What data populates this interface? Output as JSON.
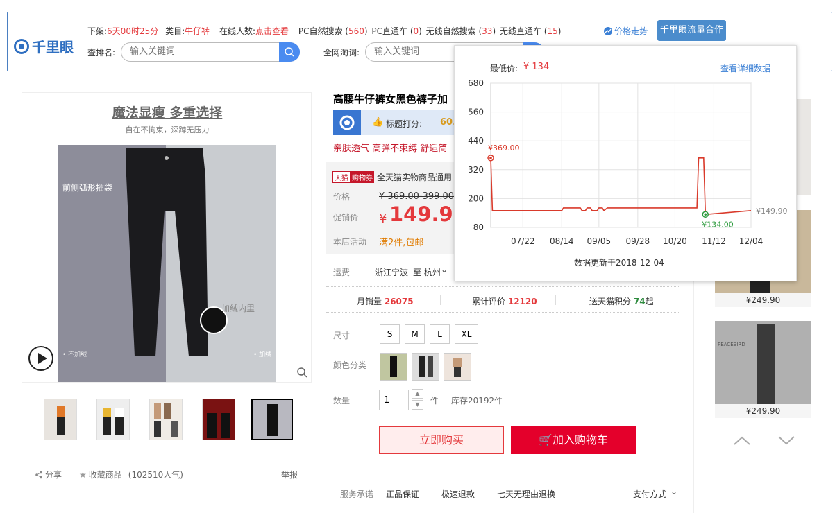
{
  "toolbar": {
    "logo_text": "千里眼",
    "shelf_label": "下架:",
    "shelf_value": "6天00时25分",
    "category_label": "类目:",
    "category_value": "牛仔裤",
    "online_label": "在线人数:",
    "online_value": "点击查看",
    "pc_natural_label": "PC自然搜索 (",
    "pc_natural_value": "560",
    "pc_direct_label": "PC直通车 (",
    "pc_direct_value": "0",
    "wireless_natural_label": "无线自然搜索 (",
    "wireless_natural_value": "33",
    "wireless_direct_label": "无线直通车 (",
    "wireless_direct_value": "15",
    "close_paren": ")",
    "price_trend": "价格走势",
    "coop_button": "千里眼流量合作",
    "rank_label": "查排名:",
    "rank_placeholder": "输入关键词",
    "web_label": "全网淘词:",
    "web_placeholder": "输入关键词"
  },
  "popup": {
    "lowest_label": "最低价:",
    "lowest_value": "¥ 134",
    "detail_link": "查看详细数据",
    "update_text": "数据更新于2018-12-04",
    "end_price_label": "¥149.90",
    "max_label": "¥369.00",
    "min_label": "¥134.00"
  },
  "chart_data": {
    "type": "line",
    "title": "",
    "ylim": [
      80,
      680
    ],
    "y_ticks": [
      "680",
      "560",
      "440",
      "320",
      "200",
      "80"
    ],
    "x_ticks": [
      "07/22",
      "08/14",
      "09/05",
      "09/28",
      "10/20",
      "11/12",
      "12/04"
    ],
    "series": [
      {
        "x": [
          "07/03",
          "07/04",
          "08/14",
          "08/15",
          "08/25",
          "08/26",
          "08/28",
          "08/29",
          "08/31",
          "09/01",
          "09/04",
          "09/05",
          "09/07",
          "09/08",
          "09/10",
          "11/02",
          "11/03",
          "11/06",
          "11/07",
          "12/04"
        ],
        "values": [
          369,
          149.9,
          149.9,
          161,
          161,
          149.9,
          149.9,
          161,
          161,
          149.9,
          149.9,
          161,
          161,
          149.9,
          161,
          161,
          369,
          369,
          134,
          149.9
        ]
      }
    ],
    "grid": true
  },
  "product": {
    "title": "高腰牛仔裤女黑色裤子加",
    "title_score_label": "标题打分:",
    "title_score_value": "60.",
    "tags_line": "亲肤透气 高弹不束缚 舒适简",
    "promo_tag1": "天猫",
    "promo_tag2": "购物券",
    "promo_text": "全天猫实物商品通用",
    "price_label": "价格",
    "price_value": "¥ 369.00-399.00",
    "promo_price_label": "促销价",
    "promo_currency": "¥",
    "promo_price_value": "149.90",
    "activity_label": "本店活动",
    "activity_value": "满2件,包邮",
    "shipping_label": "运费",
    "shipping_from": "浙江宁波",
    "shipping_to": "至 杭州",
    "monthly_label": "月销量",
    "monthly_value": "26075",
    "reviews_label": "累计评价",
    "reviews_value": "12120",
    "points_label": "送天猫积分",
    "points_value": "74",
    "points_suffix": "起",
    "size_label": "尺寸",
    "sizes": [
      "S",
      "M",
      "L",
      "XL"
    ],
    "color_label": "颜色分类",
    "qty_label": "数量",
    "qty_value": "1",
    "qty_unit": "件",
    "stock_text": "库存20192件",
    "buy_now": "立即购买",
    "add_cart": "加入购物车",
    "service_label": "服务承诺",
    "service_items": [
      "正品保证",
      "极速退款",
      "七天无理由退换"
    ],
    "payment_label": "支付方式"
  },
  "gallery": {
    "headline": "魔法显瘦 多重选择",
    "subline": "自在不拘束，深蹲无压力",
    "callout1": "前侧弧形插袋",
    "callout2": "加绒内里",
    "left_note": "• 不加绒",
    "right_note": "• 加绒",
    "share": "分享",
    "favorite": "收藏商品",
    "popularity": "(102510人气)",
    "report": "举报"
  },
  "sidebar": {
    "prices": [
      "¥249.90",
      "¥249.90"
    ],
    "brand": "PEACEBIRD"
  }
}
